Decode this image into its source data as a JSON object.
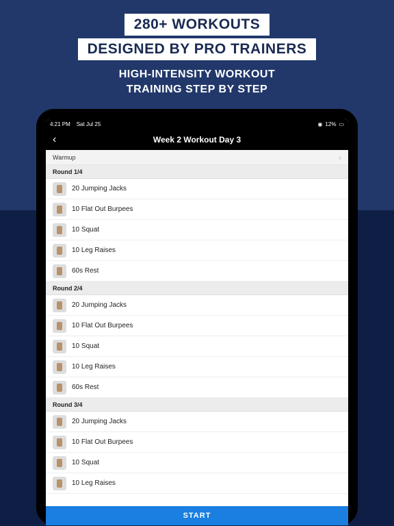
{
  "promo": {
    "badge1": "280+ WORKOUTS",
    "badge2": "DESIGNED BY PRO TRAINERS",
    "tagline1": "HIGH-INTENSITY WORKOUT",
    "tagline2": "TRAINING STEP BY STEP"
  },
  "statusbar": {
    "time": "4:21 PM",
    "date": "Sat Jul 25",
    "battery": "12%"
  },
  "nav": {
    "title": "Week 2 Workout Day 3"
  },
  "workout": {
    "warmup_label": "Warmup",
    "start_label": "START",
    "rounds": [
      {
        "header": "Round 1/4",
        "exercises": [
          "20 Jumping Jacks",
          "10 Flat Out Burpees",
          "10 Squat",
          "10 Leg Raises",
          "60s Rest"
        ]
      },
      {
        "header": "Round 2/4",
        "exercises": [
          "20 Jumping Jacks",
          "10 Flat Out Burpees",
          "10 Squat",
          "10 Leg Raises",
          "60s Rest"
        ]
      },
      {
        "header": "Round 3/4",
        "exercises": [
          "20 Jumping Jacks",
          "10 Flat Out Burpees",
          "10 Squat",
          "10 Leg Raises"
        ]
      }
    ]
  }
}
